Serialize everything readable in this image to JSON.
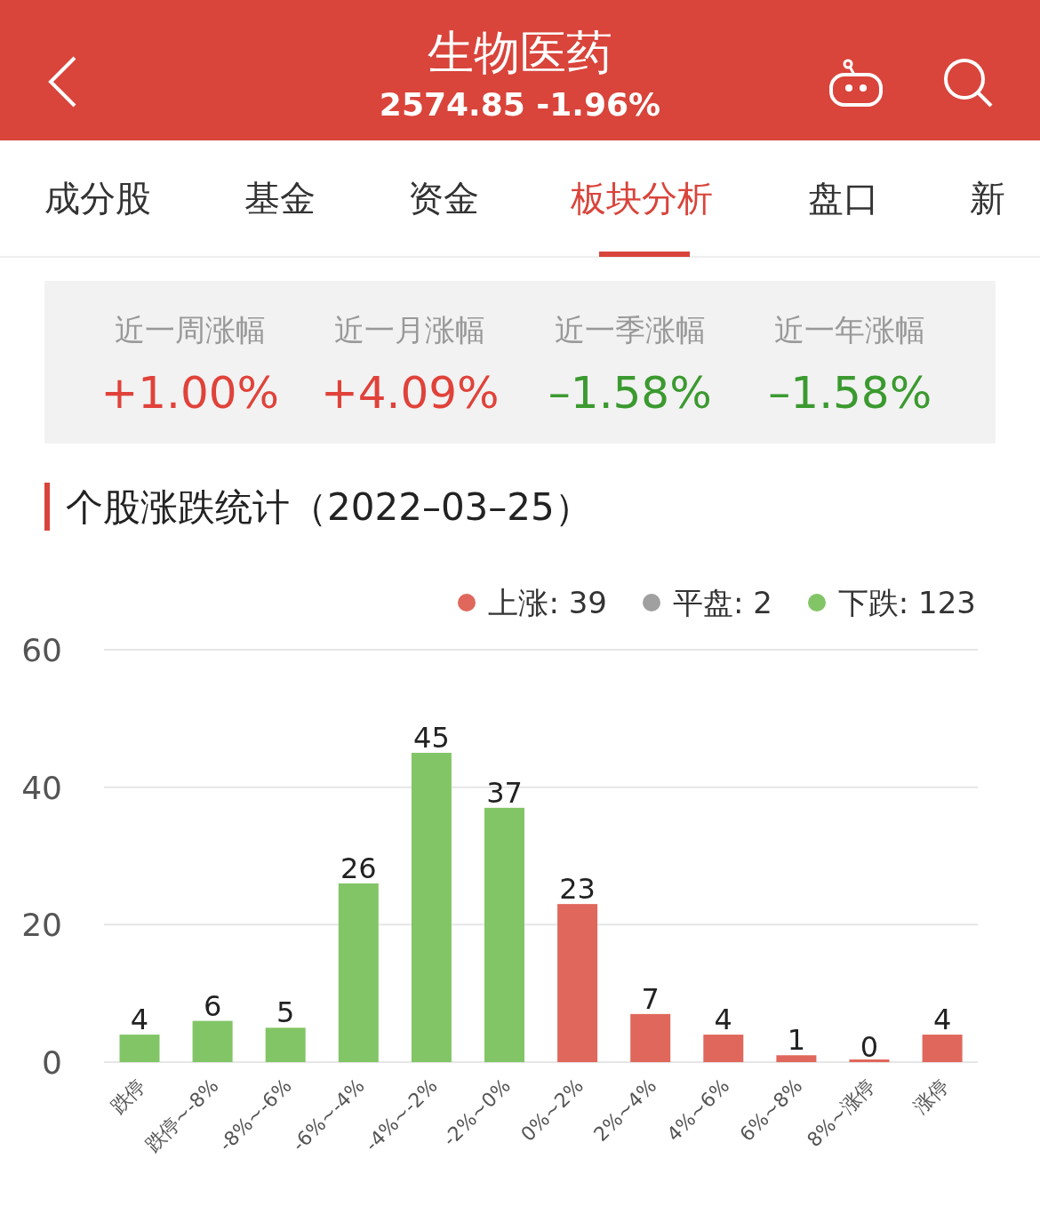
{
  "header": {
    "title": "生物医药",
    "subtitle": "2574.85 -1.96%"
  },
  "tabs": [
    {
      "label": "成分股",
      "selected": false
    },
    {
      "label": "基金",
      "selected": false
    },
    {
      "label": "资金",
      "selected": false
    },
    {
      "label": "板块分析",
      "selected": true
    },
    {
      "label": "盘口",
      "selected": false
    },
    {
      "label": "新",
      "selected": false
    }
  ],
  "stats": [
    {
      "label": "近一周涨幅",
      "value": "+1.00%",
      "color": "#e0423a"
    },
    {
      "label": "近一月涨幅",
      "value": "+4.09%",
      "color": "#e0423a"
    },
    {
      "label": "近一季涨幅",
      "value": "–1.58%",
      "color": "#3b9a2f"
    },
    {
      "label": "近一年涨幅",
      "value": "–1.58%",
      "color": "#3b9a2f"
    }
  ],
  "section_title": "个股涨跌统计（2022–03–25）",
  "legend": [
    {
      "label": "上涨: 39",
      "color": "#e0675c"
    },
    {
      "label": "平盘: 2",
      "color": "#a0a0a0"
    },
    {
      "label": "下跌: 123",
      "color": "#82c566"
    }
  ],
  "chart_data": {
    "type": "bar",
    "categories": [
      "跌停",
      "跌停~-8%",
      "-8%~-6%",
      "-6%~-4%",
      "-4%~-2%",
      "-2%~0%",
      "0%~2%",
      "2%~4%",
      "4%~6%",
      "6%~8%",
      "8%~涨停",
      "涨停"
    ],
    "series": [
      {
        "color": "#82c566",
        "values": [
          4,
          6,
          5,
          26,
          45,
          37,
          null,
          null,
          null,
          null,
          null,
          null
        ]
      },
      {
        "color": "#e0675c",
        "values": [
          null,
          null,
          null,
          null,
          null,
          null,
          23,
          7,
          4,
          1,
          0,
          4
        ]
      }
    ],
    "ylim": [
      0,
      60
    ],
    "yticks": [
      0,
      20,
      40,
      60
    ],
    "data_labels": true
  }
}
